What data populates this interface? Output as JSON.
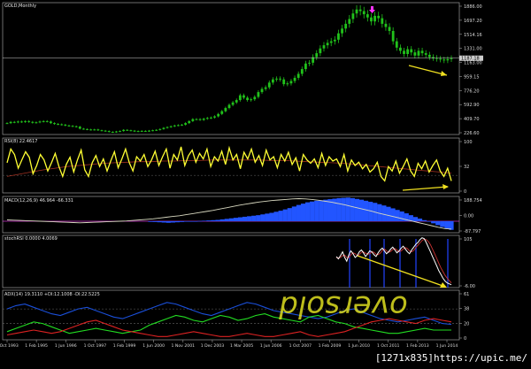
{
  "panels": {
    "price": {
      "title": "GOLD,Monthly",
      "yticks": [
        "1886.00",
        "1697.20",
        "1514.16",
        "1331.00",
        "1163.00",
        "959.15",
        "776.20",
        "592.90",
        "409.70",
        "226.60"
      ],
      "current_price": "1187.18"
    },
    "rsi": {
      "title": "RSI(8) 22.4617",
      "yticks": [
        "100",
        "32",
        "0"
      ]
    },
    "macd": {
      "title": "MACD(12,26,9) 46.964 -66.331",
      "yticks": [
        "188.754",
        "0.00",
        "-87.797"
      ]
    },
    "stoch": {
      "title": "stochRSI 0.0000 4.0069",
      "yticks": [
        "105",
        "-6.00"
      ]
    },
    "adx": {
      "title": "ADX(14) 19.3110 +DI:12.1008 -DI:22.5225",
      "yticks": [
        "61",
        "38",
        "20",
        "0"
      ],
      "annotation": "oversold"
    }
  },
  "x_axis": {
    "labels": [
      "2 Oct 1993",
      "1 Feb 1995",
      "1 Jun 1996",
      "1 Oct 1997",
      "1 Feb 1999",
      "1 Jun 2000",
      "1 Nov 2001",
      "1 Dec 2003",
      "1 Mar 2005",
      "1 Jun 2006",
      "1 Oct 2007",
      "1 Feb 2009",
      "1 Jun 2010",
      "1 Oct 2011",
      "1 Feb 2013",
      "1 Jun 2014"
    ]
  },
  "watermark": "[1271x835]https://upic.me/",
  "colors": {
    "background": "#000000",
    "candles": "#21c21b",
    "rsi_line": "#ffff33",
    "macd_hist": "#2255ff",
    "macd_signal": "#d8d8c0",
    "trend_arrow": "#f0e020",
    "adx_line": "#1a4fd9",
    "plus_di": "#22dd22",
    "minus_di": "#dd2222",
    "top_marker": "#ff33ff"
  },
  "chart_data": [
    {
      "type": "line",
      "title": "GOLD,Monthly",
      "x_start": "1993-10",
      "x_end": "2014-12",
      "ylim": [
        226.6,
        1886.0
      ],
      "series": [
        {
          "values": [
            370,
            385,
            380,
            390,
            385,
            395,
            385,
            375,
            380,
            390,
            395,
            390,
            370,
            360,
            355,
            350,
            340,
            335,
            330,
            325,
            300,
            295,
            290,
            285,
            290,
            280,
            275,
            270,
            260,
            255,
            265,
            270,
            285,
            280,
            275,
            265,
            270,
            272,
            268,
            275,
            280,
            285,
            295,
            310,
            320,
            330,
            340,
            345,
            350,
            370,
            395,
            420,
            420,
            410,
            425,
            435,
            440,
            455,
            485,
            520,
            560,
            600,
            630,
            660,
            720,
            690,
            660,
            670,
            700,
            760,
            800,
            820,
            880,
            920,
            930,
            920,
            860,
            870,
            900,
            940,
            990,
            1050,
            1120,
            1130,
            1200,
            1250,
            1310,
            1350,
            1380,
            1400,
            1420,
            1500,
            1560,
            1620,
            1680,
            1750,
            1800,
            1780,
            1740,
            1700,
            1650,
            1720,
            1690,
            1620,
            1580,
            1530,
            1400,
            1320,
            1280,
            1240,
            1300,
            1260,
            1220,
            1280,
            1250,
            1230,
            1200,
            1190,
            1180,
            1170,
            1160,
            1175,
            1187
          ]
        }
      ]
    },
    {
      "type": "line",
      "title": "RSI(8) 22.4617",
      "ylim": [
        0,
        100
      ],
      "series": [
        {
          "values": [
            55,
            80,
            70,
            45,
            60,
            75,
            65,
            35,
            50,
            70,
            60,
            40,
            55,
            72,
            48,
            30,
            52,
            65,
            38,
            60,
            78,
            42,
            30,
            55,
            68,
            48,
            62,
            40,
            58,
            75,
            46,
            62,
            80,
            55,
            40,
            66,
            58,
            70,
            48,
            60,
            76,
            50,
            66,
            80,
            45,
            70,
            60,
            84,
            50,
            68,
            78,
            56,
            72,
            62,
            80,
            48,
            66,
            58,
            76,
            52,
            82,
            60,
            70,
            44,
            74,
            62,
            80,
            56,
            68,
            50,
            78,
            60,
            66,
            46,
            70,
            58,
            74,
            52,
            64,
            40,
            70,
            60,
            54,
            62,
            46,
            72,
            50,
            66,
            58,
            62,
            48,
            70,
            40,
            60,
            50,
            56,
            44,
            52,
            38,
            44,
            56,
            30,
            22,
            48,
            40,
            58,
            36,
            48,
            62,
            40,
            30,
            54,
            44,
            58,
            38,
            50,
            60,
            40,
            30,
            45,
            22
          ]
        },
        {
          "values": [
            30,
            34,
            38,
            42,
            45,
            48,
            50,
            52,
            54,
            55,
            56,
            57,
            57,
            58,
            58,
            59,
            59,
            60,
            60,
            60,
            60,
            60,
            59,
            59,
            58,
            57,
            56,
            55,
            54,
            52,
            50,
            48,
            46,
            44,
            42,
            40,
            38,
            36
          ]
        }
      ]
    },
    {
      "type": "bar",
      "title": "MACD(12,26,9) 46.964 -66.331",
      "ylim": [
        -87.797,
        188.754
      ],
      "series": [
        {
          "name": "MACD",
          "values": [
            -5,
            -6,
            -8,
            -10,
            -12,
            -10,
            -8,
            -6,
            -4,
            -2,
            0,
            2,
            4,
            6,
            8,
            10,
            14,
            18,
            22,
            26,
            30,
            34,
            38,
            42,
            46,
            52,
            58,
            64,
            72,
            80,
            90,
            100,
            112,
            124,
            134,
            144,
            150,
            156,
            160,
            164,
            168,
            172,
            176,
            178,
            180,
            176,
            170,
            164,
            156,
            148,
            140,
            130,
            120,
            110,
            98,
            86,
            74,
            60,
            46,
            32,
            20,
            8,
            -4,
            -16,
            -30,
            -44,
            -56,
            -66
          ]
        },
        {
          "name": "signal",
          "values": [
            10,
            8,
            6,
            4,
            2,
            0,
            -2,
            -4,
            -6,
            -8,
            -10,
            -12,
            -10,
            -8,
            -6,
            -4,
            -2,
            0,
            2,
            6,
            10,
            14,
            18,
            24,
            30,
            36,
            42,
            50,
            58,
            66,
            74,
            82,
            92,
            102,
            112,
            122,
            130,
            138,
            146,
            152,
            158,
            162,
            166,
            170,
            172,
            170,
            166,
            160,
            152,
            144,
            134,
            124,
            112,
            100,
            88,
            76,
            62,
            50,
            38,
            26,
            14,
            2,
            -10,
            -22,
            -34,
            -46,
            -56,
            -60
          ]
        }
      ]
    },
    {
      "type": "line",
      "title": "stochRSI 0.0000 4.0069",
      "ylim": [
        -6,
        105
      ],
      "series": [
        {
          "values": [
            60,
            55,
            62,
            70,
            58,
            50,
            64,
            72,
            66,
            58,
            62,
            70,
            74,
            68,
            60,
            66,
            72,
            70,
            64,
            60,
            68,
            74,
            78,
            72,
            66,
            70,
            76,
            80,
            74,
            68,
            72,
            78,
            82,
            76,
            70,
            66,
            74,
            80,
            86,
            90,
            96,
            100,
            98,
            90,
            80,
            70,
            60,
            50,
            40,
            30,
            22,
            14,
            8,
            4,
            2,
            0
          ]
        },
        {
          "values": [
            58,
            57,
            58,
            62,
            63,
            58,
            58,
            64,
            68,
            66,
            62,
            64,
            69,
            70,
            67,
            65,
            66,
            70,
            69,
            65,
            64,
            67,
            73,
            76,
            72,
            69,
            71,
            75,
            77,
            74,
            70,
            72,
            76,
            79,
            77,
            72,
            70,
            73,
            79,
            84,
            89,
            94,
            97,
            96,
            92,
            85,
            76,
            66,
            56,
            46,
            36,
            28,
            20,
            14,
            9,
            4
          ]
        }
      ]
    },
    {
      "type": "line",
      "title": "ADX(14) 19.3110 +DI:12.1008 -DI:22.5225",
      "ylim": [
        0,
        61
      ],
      "series": [
        {
          "name": "ADX",
          "values": [
            38,
            42,
            44,
            40,
            36,
            32,
            30,
            34,
            38,
            40,
            36,
            32,
            28,
            26,
            30,
            34,
            38,
            42,
            46,
            44,
            40,
            36,
            32,
            30,
            34,
            38,
            42,
            46,
            44,
            40,
            36,
            34,
            32,
            30,
            28,
            26,
            28,
            32,
            36,
            38,
            34,
            30,
            26,
            24,
            22,
            24,
            26,
            28,
            24,
            20,
            19
          ]
        },
        {
          "name": "+DI",
          "values": [
            10,
            14,
            18,
            22,
            20,
            16,
            12,
            8,
            10,
            12,
            14,
            12,
            10,
            8,
            10,
            12,
            18,
            22,
            26,
            30,
            28,
            24,
            22,
            26,
            30,
            28,
            24,
            26,
            30,
            32,
            28,
            26,
            24,
            22,
            28,
            30,
            26,
            22,
            20,
            16,
            14,
            12,
            10,
            8,
            8,
            10,
            12,
            14,
            12,
            12,
            12
          ]
        },
        {
          "name": "-DI",
          "values": [
            6,
            8,
            10,
            12,
            10,
            8,
            10,
            14,
            18,
            22,
            24,
            20,
            16,
            12,
            10,
            8,
            6,
            4,
            4,
            6,
            8,
            10,
            8,
            6,
            4,
            4,
            6,
            8,
            6,
            4,
            4,
            6,
            8,
            10,
            6,
            4,
            6,
            8,
            10,
            14,
            18,
            22,
            24,
            26,
            24,
            22,
            20,
            24,
            26,
            24,
            22
          ]
        }
      ]
    }
  ]
}
